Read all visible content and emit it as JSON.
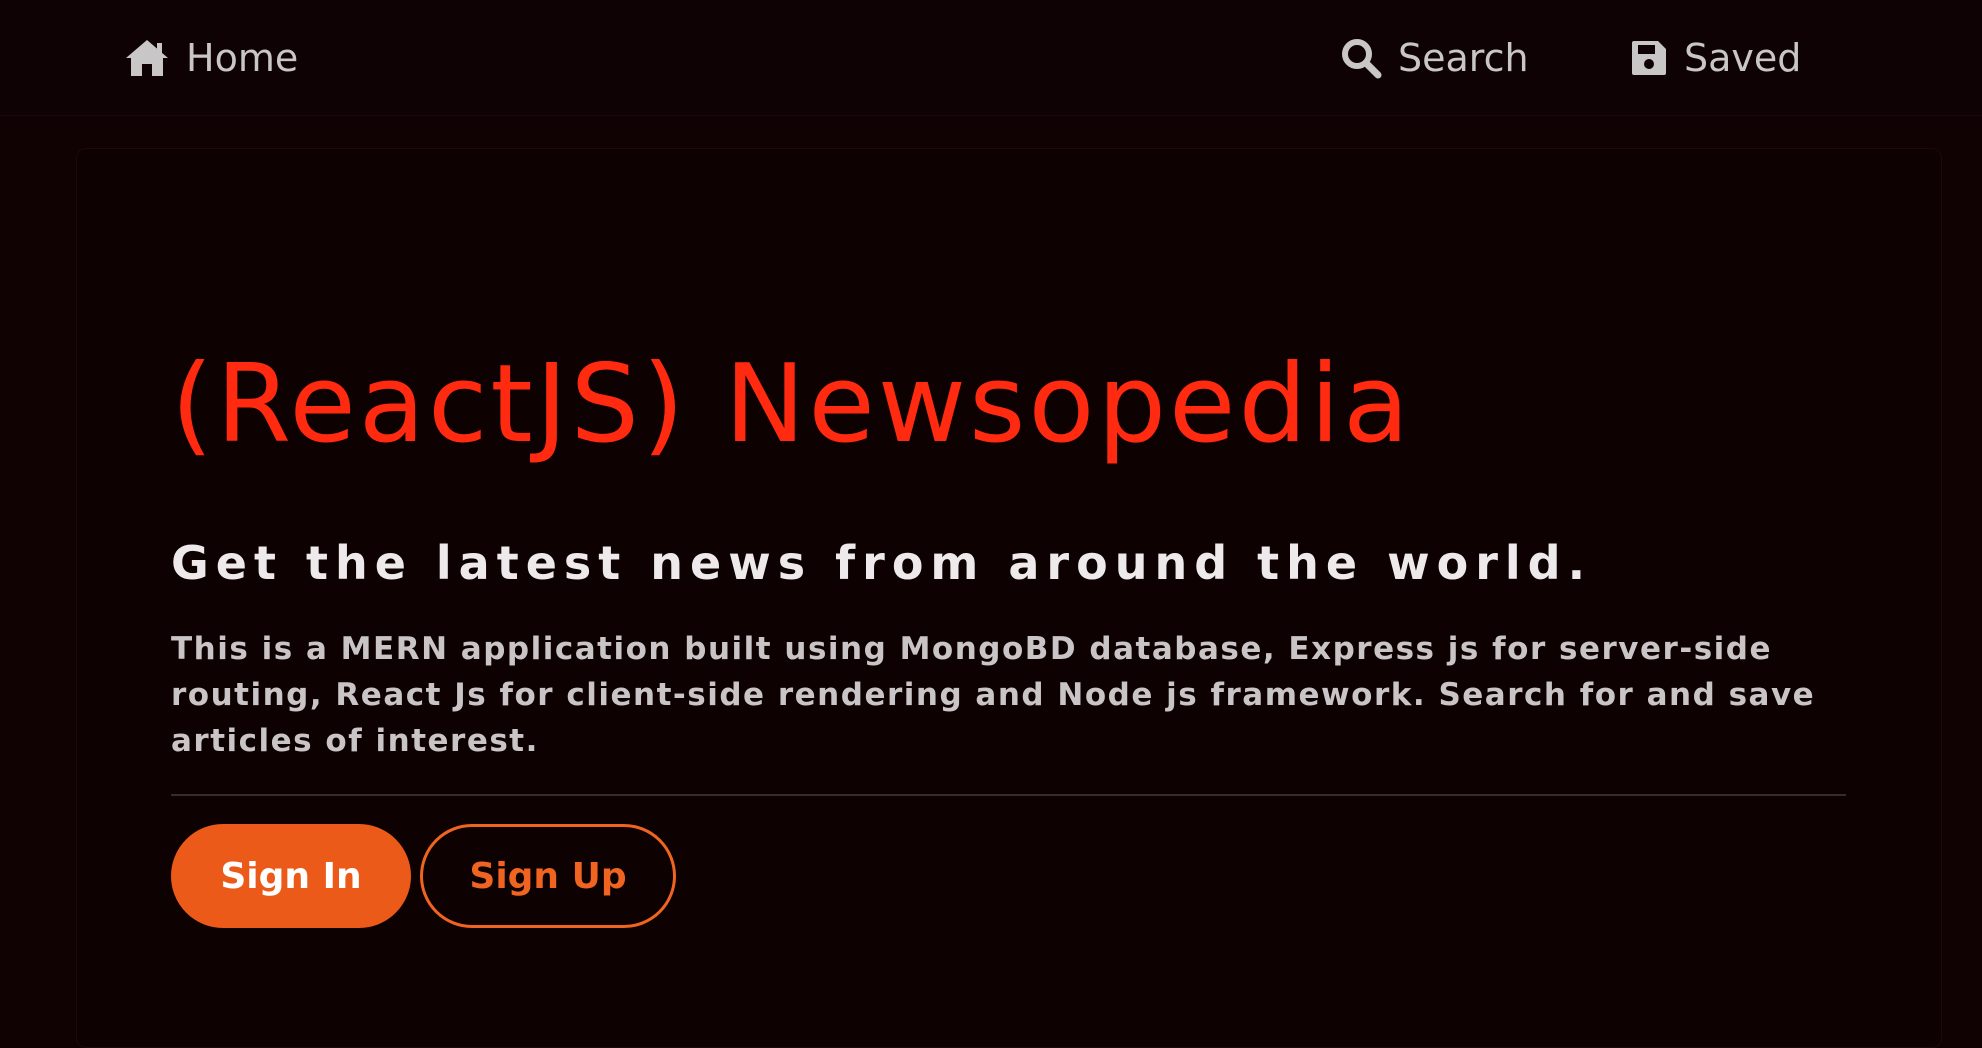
{
  "colors": {
    "background": "#100203",
    "title": "#ff2a0f",
    "accent": "#ec5a1a",
    "nav_text": "#c9c6c7"
  },
  "nav": {
    "home": {
      "label": "Home",
      "icon": "home-icon"
    },
    "search": {
      "label": "Search",
      "icon": "search-icon"
    },
    "saved": {
      "label": "Saved",
      "icon": "save-icon"
    }
  },
  "hero": {
    "title": "(ReactJS) Newsopedia",
    "subtitle": "Get the latest news from around the world.",
    "description": "This is a MERN application built using MongoBD database, Express js for server-side routing, React Js for client-side rendering and Node js framework. Search for and save articles of interest."
  },
  "buttons": {
    "sign_in": "Sign In",
    "sign_up": "Sign Up"
  }
}
